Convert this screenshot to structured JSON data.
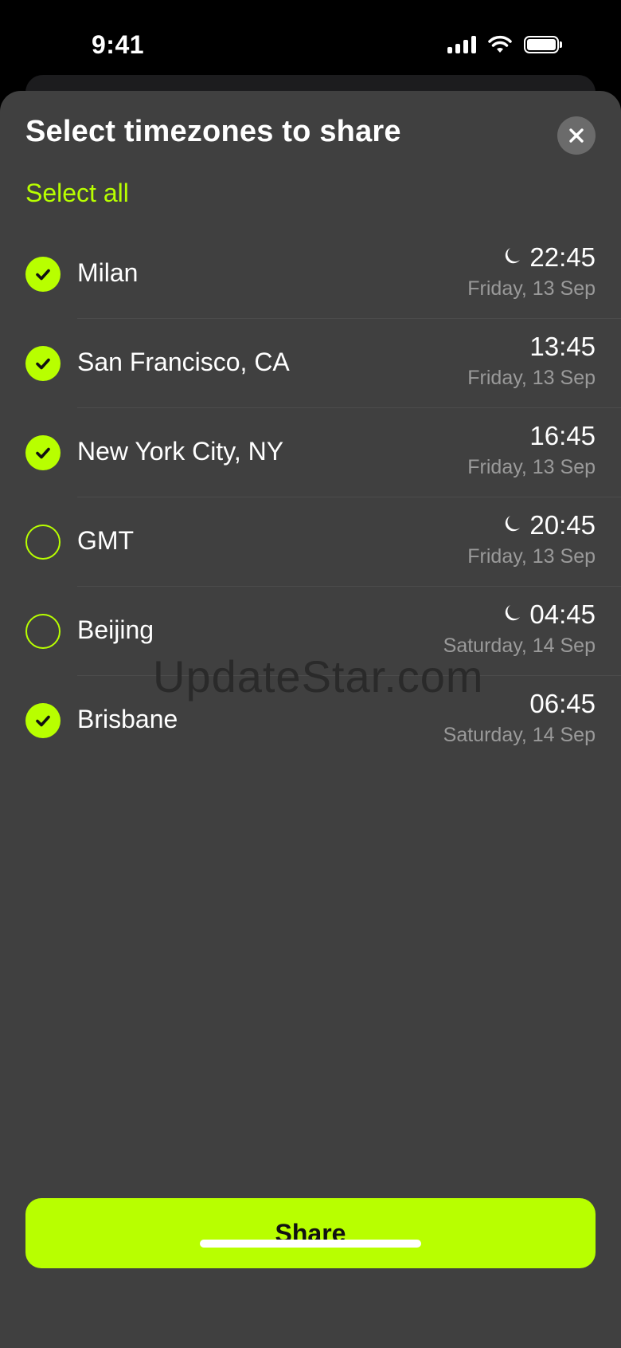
{
  "status_bar": {
    "time": "9:41",
    "icons": [
      "signal-icon",
      "wifi-icon",
      "battery-icon"
    ]
  },
  "sheet": {
    "title": "Select timezones to share",
    "select_all_label": "Select all",
    "close_icon": "close-icon",
    "share_label": "Share"
  },
  "timezones": [
    {
      "name": "Milan",
      "time": "22:45",
      "date": "Friday, 13 Sep",
      "selected": true,
      "night": true
    },
    {
      "name": "San Francisco, CA",
      "time": "13:45",
      "date": "Friday, 13 Sep",
      "selected": true,
      "night": false
    },
    {
      "name": "New York City, NY",
      "time": "16:45",
      "date": "Friday, 13 Sep",
      "selected": true,
      "night": false
    },
    {
      "name": "GMT",
      "time": "20:45",
      "date": "Friday, 13 Sep",
      "selected": false,
      "night": true
    },
    {
      "name": "Beijing",
      "time": "04:45",
      "date": "Saturday, 14 Sep",
      "selected": false,
      "night": true
    },
    {
      "name": "Brisbane",
      "time": "06:45",
      "date": "Saturday, 14 Sep",
      "selected": true,
      "night": false
    }
  ],
  "watermark": "UpdateStar.com",
  "colors": {
    "accent": "#b8ff00",
    "sheet_background": "#404040",
    "secondary_text": "#9a9a9a"
  }
}
